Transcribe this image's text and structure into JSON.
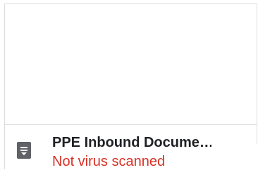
{
  "file_card": {
    "title": "PPE Inbound Documents",
    "status": "Not virus scanned",
    "icon": "document-icon",
    "status_color": "#d93025"
  }
}
